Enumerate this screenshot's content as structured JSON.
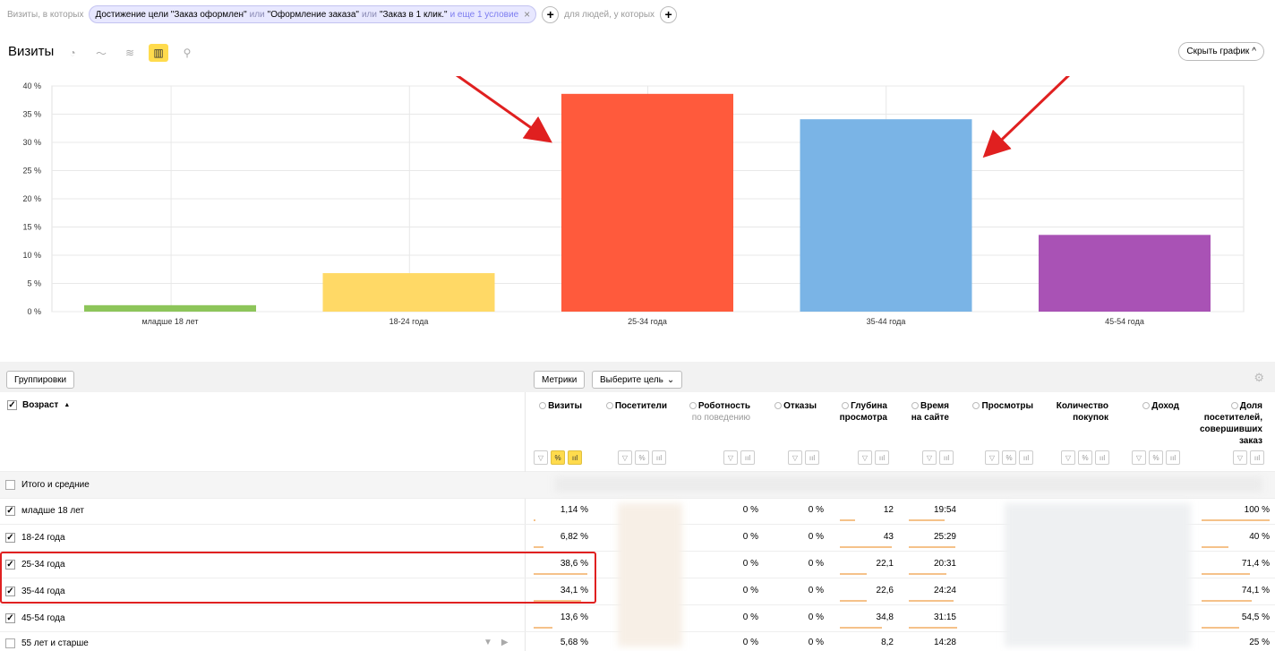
{
  "segment": {
    "prefix": "Визиты, в которых",
    "chip_goal1": "Достижение цели \"Заказ оформлен\"",
    "or1": "или",
    "chip_goal2": "\"Оформление заказа\"",
    "or2": "или",
    "chip_goal3": "\"Заказ в 1 клик.\"",
    "more": "и еще 1 условие",
    "people_label": "для людей, у которых"
  },
  "chart_header": {
    "title": "Визиты",
    "hide_label": "Скрыть график"
  },
  "icons": {
    "pie": "pie-chart-icon",
    "line": "line-chart-icon",
    "area": "area-chart-icon",
    "bar": "bar-chart-icon",
    "map": "map-pin-icon",
    "settings": "gear-icon"
  },
  "colors": {
    "accent": "#ffdb4d",
    "highlight": "#e02020",
    "arrow": "#e02020"
  },
  "chart_data": {
    "type": "bar",
    "categories": [
      "младше 18 лет",
      "18-24 года",
      "25-34 года",
      "35-44 года",
      "45-54 года"
    ],
    "values": [
      1.14,
      6.82,
      38.6,
      34.1,
      13.6
    ],
    "bar_colors": [
      "#8dc55a",
      "#ffd966",
      "#ff5a3c",
      "#7ab4e6",
      "#a952b5"
    ],
    "yticks": [
      "0 %",
      "5 %",
      "10 %",
      "15 %",
      "20 %",
      "25 %",
      "30 %",
      "35 %",
      "40 %"
    ],
    "ylim": [
      0,
      40
    ],
    "grid": true
  },
  "toolbar": {
    "groupings": "Группировки",
    "metrics": "Метрики",
    "choose_goal": "Выберите цель"
  },
  "table": {
    "age_header": "Возраст",
    "sort_mark": "▲",
    "headers": {
      "visits": "Визиты",
      "visitors": "Посетители",
      "robot": "Роботность",
      "robot_sub": "по поведению",
      "bounces": "Отказы",
      "depth1": "Глубина",
      "depth2": "просмотра",
      "time1": "Время",
      "time2": "на сайте",
      "views": "Просмотры",
      "purchases1": "Количество",
      "purchases2": "покупок",
      "revenue": "Доход",
      "share1": "Доля",
      "share2": "посетителей,",
      "share3": "совершивших",
      "share4": "заказ"
    },
    "total_label": "Итого и средние",
    "rows": [
      {
        "label": "младше 18 лет",
        "visits": "1,14 %",
        "robot": "0 %",
        "bounces": "0 %",
        "depth": "12",
        "time": "19:54",
        "share": "100 %"
      },
      {
        "label": "18-24 года",
        "visits": "6,82 %",
        "robot": "0 %",
        "bounces": "0 %",
        "depth": "43",
        "time": "25:29",
        "share": "40 %"
      },
      {
        "label": "25-34 года",
        "visits": "38,6 %",
        "robot": "0 %",
        "bounces": "0 %",
        "depth": "22,1",
        "time": "20:31",
        "share": "71,4 %"
      },
      {
        "label": "35-44 года",
        "visits": "34,1 %",
        "robot": "0 %",
        "bounces": "0 %",
        "depth": "22,6",
        "time": "24:24",
        "share": "74,1 %"
      },
      {
        "label": "45-54 года",
        "visits": "13,6 %",
        "robot": "0 %",
        "bounces": "0 %",
        "depth": "34,8",
        "time": "31:15",
        "share": "54,5 %"
      },
      {
        "label": "55 лет и старше",
        "visits": "5,68 %",
        "robot": "0 %",
        "bounces": "0 %",
        "depth": "8,2",
        "time": "14:28",
        "share": "25 %"
      }
    ]
  }
}
